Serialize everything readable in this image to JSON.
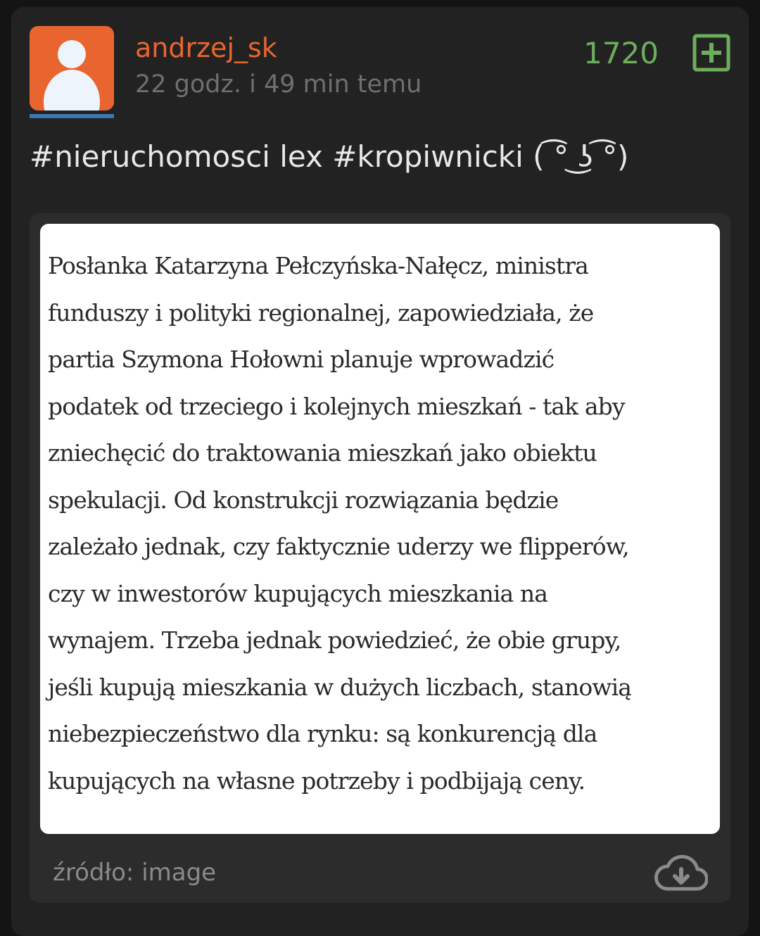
{
  "post": {
    "author": "andrzej_sk",
    "time": "22 godz. i 49 min temu",
    "score": "1720",
    "text": "#nieruchomosci lex #kropiwnicki ( ͡° ͜ʖ ͡°)",
    "image_text": "Posłanka Katarzyna Pełczyńska-Nałęcz, ministra\nfunduszy i polityki regionalnej, zapowiedziała, że\npartia Szymona Hołowni planuje wprowadzić\npodatek od trzeciego i kolejnych mieszkań - tak aby\nzniechęcić do traktowania mieszkań jako obiektu\nspekulacji. Od konstrukcji rozwiązania będzie\nzależało jednak, czy faktycznie uderzy we flipperów,\nczy w inwestorów kupujących mieszkania na\nwynajem. Trzeba jednak powiedzieć, że obie grupy,\njeśli kupują mieszkania w dużych liczbach, stanowią\nniebezpieczeństwo dla rynku: są konkurencją dla\nkupujących na własne potrzeby i podbijają ceny.",
    "source_label": "źródło: ",
    "source_link": "image"
  },
  "icons": {
    "avatar": "user-silhouette-icon",
    "vote": "plus-square-icon",
    "download": "cloud-download-icon"
  },
  "colors": {
    "background": "#141414",
    "card": "#222222",
    "accent_orange": "#e8652f",
    "score_green": "#6cae5c",
    "avatar_underline": "#3b77b0"
  }
}
